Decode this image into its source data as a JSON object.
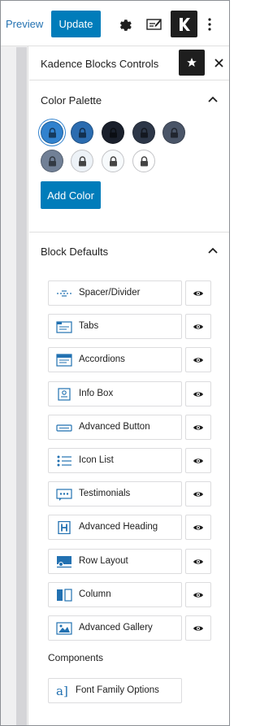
{
  "toolbar": {
    "preview_label": "Preview",
    "update_label": "Update",
    "settings_icon": "gear-icon",
    "editor_icon": "edit-screen-icon",
    "kadence_icon": "kadence-k-icon",
    "more_icon": "vertical-ellipsis-icon"
  },
  "panel": {
    "title": "Kadence Blocks Controls",
    "star_icon": "star-icon",
    "close_icon": "close-icon"
  },
  "color_palette": {
    "title": "Color Palette",
    "add_color_label": "Add Color",
    "swatches": [
      {
        "color": "#3182ce",
        "lock": "lock-icon"
      },
      {
        "color": "#2b6cb0",
        "lock": "lock-icon"
      },
      {
        "color": "#1a202c",
        "lock": "lock-icon"
      },
      {
        "color": "#2d3748",
        "lock": "lock-icon"
      },
      {
        "color": "#4a5568",
        "lock": "lock-icon"
      },
      {
        "color": "#718096",
        "lock": "lock-icon"
      },
      {
        "color": "#edf2f7",
        "lock": "lock-icon"
      },
      {
        "color": "#f7fafc",
        "lock": "lock-icon"
      },
      {
        "color": "#ffffff",
        "lock": "lock-icon"
      }
    ]
  },
  "block_defaults": {
    "title": "Block Defaults",
    "items": [
      {
        "label": "Spacer/Divider",
        "icon": "spacer-icon"
      },
      {
        "label": "Tabs",
        "icon": "tabs-icon"
      },
      {
        "label": "Accordions",
        "icon": "accordion-icon"
      },
      {
        "label": "Info Box",
        "icon": "info-box-icon"
      },
      {
        "label": "Advanced Button",
        "icon": "button-icon"
      },
      {
        "label": "Icon List",
        "icon": "icon-list-icon"
      },
      {
        "label": "Testimonials",
        "icon": "testimonials-icon"
      },
      {
        "label": "Advanced Heading",
        "icon": "heading-icon"
      },
      {
        "label": "Row Layout",
        "icon": "row-layout-icon"
      },
      {
        "label": "Column",
        "icon": "column-icon"
      },
      {
        "label": "Advanced Gallery",
        "icon": "gallery-icon"
      }
    ],
    "visibility_icon": "eye-icon"
  },
  "components": {
    "title": "Components",
    "font_family_label": "Font Family Options",
    "font_family_icon": "font-a-icon"
  },
  "colors": {
    "accent": "#007cba",
    "link": "#2271b1",
    "icon_blue": "#2271b1",
    "dark": "#1e1e1e"
  }
}
